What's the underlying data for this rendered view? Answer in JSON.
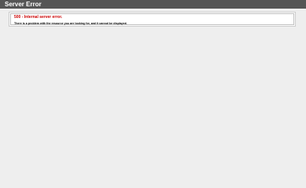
{
  "header": {
    "title": "Server Error"
  },
  "error": {
    "heading": "500 - Internal server error.",
    "message": "There is a problem with the resource you are looking for, and it cannot be displayed."
  },
  "colors": {
    "header_bg": "#555555",
    "page_bg": "#eeeeee",
    "heading_text": "#cc0000"
  }
}
